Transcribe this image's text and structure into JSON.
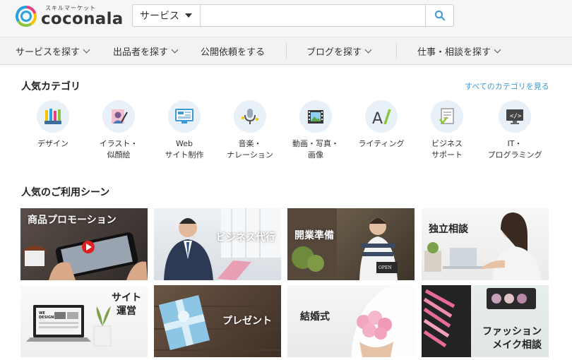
{
  "brand": {
    "tagline": "スキルマーケット",
    "name": "coconala",
    "colors": {
      "ring_blue": "#2aa3dc",
      "ring_green": "#8cc63f",
      "ring_yellow": "#f6c400",
      "ring_pink": "#e8407f",
      "link": "#3d9ad6"
    }
  },
  "search": {
    "category": "サービス",
    "query": "",
    "placeholder": "",
    "button_icon": "search-icon"
  },
  "nav": {
    "items": [
      {
        "label": "サービスを探す",
        "has_dropdown": true
      },
      {
        "label": "出品者を探す",
        "has_dropdown": true
      },
      {
        "label": "公開依頼をする",
        "has_dropdown": false
      },
      {
        "label": "ブログを探す",
        "has_dropdown": true
      },
      {
        "label": "仕事・相談を探す",
        "has_dropdown": true
      }
    ]
  },
  "categories": {
    "title": "人気カテゴリ",
    "see_all": "すべてのカテゴリを見る",
    "items": [
      {
        "line1": "デザイン",
        "line2": "",
        "icon": "design-icon"
      },
      {
        "line1": "イラスト・",
        "line2": "似顔絵",
        "icon": "illustration-icon"
      },
      {
        "line1": "Web",
        "line2": "サイト制作",
        "icon": "web-icon"
      },
      {
        "line1": "音楽・",
        "line2": "ナレーション",
        "icon": "microphone-icon"
      },
      {
        "line1": "動画・写真・",
        "line2": "画像",
        "icon": "film-icon"
      },
      {
        "line1": "ライティング",
        "line2": "",
        "icon": "writing-icon"
      },
      {
        "line1": "ビジネス",
        "line2": "サポート",
        "icon": "document-check-icon"
      },
      {
        "line1": "IT・",
        "line2": "プログラミング",
        "icon": "code-monitor-icon"
      }
    ]
  },
  "scenes": {
    "title": "人気のご利用シーン",
    "tiles": [
      {
        "line1": "商品プロモーション",
        "line2": ""
      },
      {
        "line1": "ビジネス代行",
        "line2": ""
      },
      {
        "line1": "開業準備",
        "line2": "",
        "sign": "OPEN"
      },
      {
        "line1": "独立相談",
        "line2": ""
      },
      {
        "line1": "サイト",
        "line2": "運営",
        "sign": "WE DESIGN"
      },
      {
        "line1": "プレゼント",
        "line2": ""
      },
      {
        "line1": "結婚式",
        "line2": ""
      },
      {
        "line1": "ファッション",
        "line2": "メイク相談"
      }
    ]
  }
}
